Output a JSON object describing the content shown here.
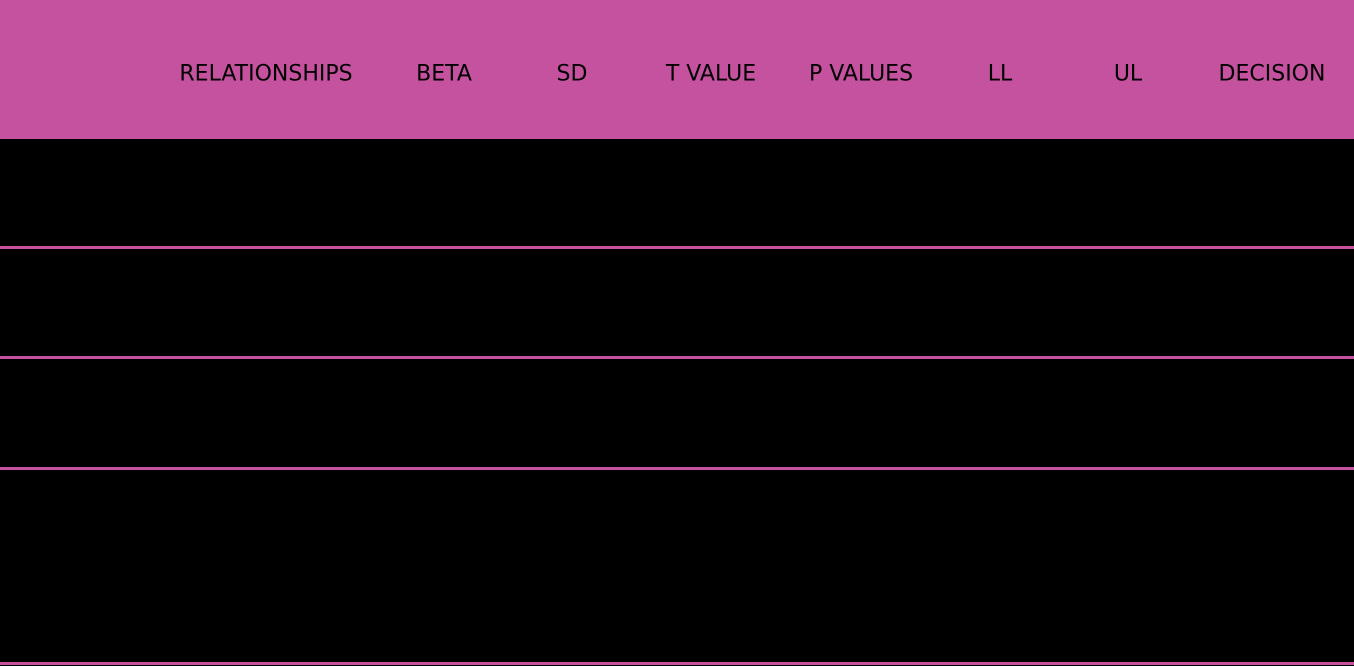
{
  "table": {
    "columns": [
      "RELATIONSHIPS",
      "BETA",
      "SD",
      "T VALUE",
      "P VALUES",
      "LL",
      "UL",
      "DECISION"
    ],
    "rows": [
      {
        "cells": [
          "",
          "",
          "",
          "",
          "",
          "",
          "",
          ""
        ]
      },
      {
        "cells": [
          "",
          "",
          "",
          "",
          "",
          "",
          "",
          ""
        ]
      },
      {
        "cells": [
          "",
          "",
          "",
          "",
          "",
          "",
          "",
          ""
        ]
      },
      {
        "cells": [
          "",
          "",
          "",
          "",
          "",
          "",
          "",
          ""
        ]
      }
    ]
  },
  "colors": {
    "header_bg": "#C5529F",
    "header_text": "#000000",
    "row_bg": "#000000",
    "divider": "#C5529F"
  }
}
